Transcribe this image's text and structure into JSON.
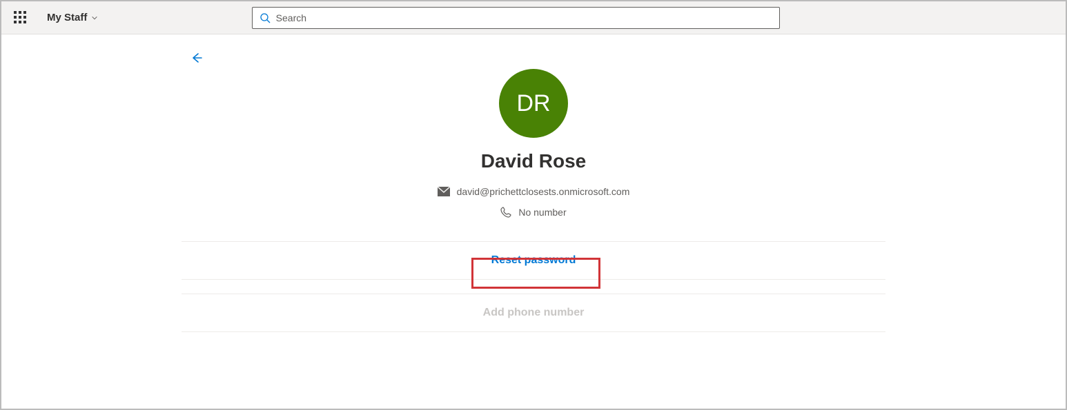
{
  "header": {
    "app_title": "My Staff",
    "search_placeholder": "Search"
  },
  "profile": {
    "initials": "DR",
    "name": "David Rose",
    "email": "david@prichettclosests.onmicrosoft.com",
    "phone": "No number",
    "avatar_color": "#498205"
  },
  "actions": {
    "reset_password": "Reset password",
    "add_phone": "Add phone number"
  }
}
